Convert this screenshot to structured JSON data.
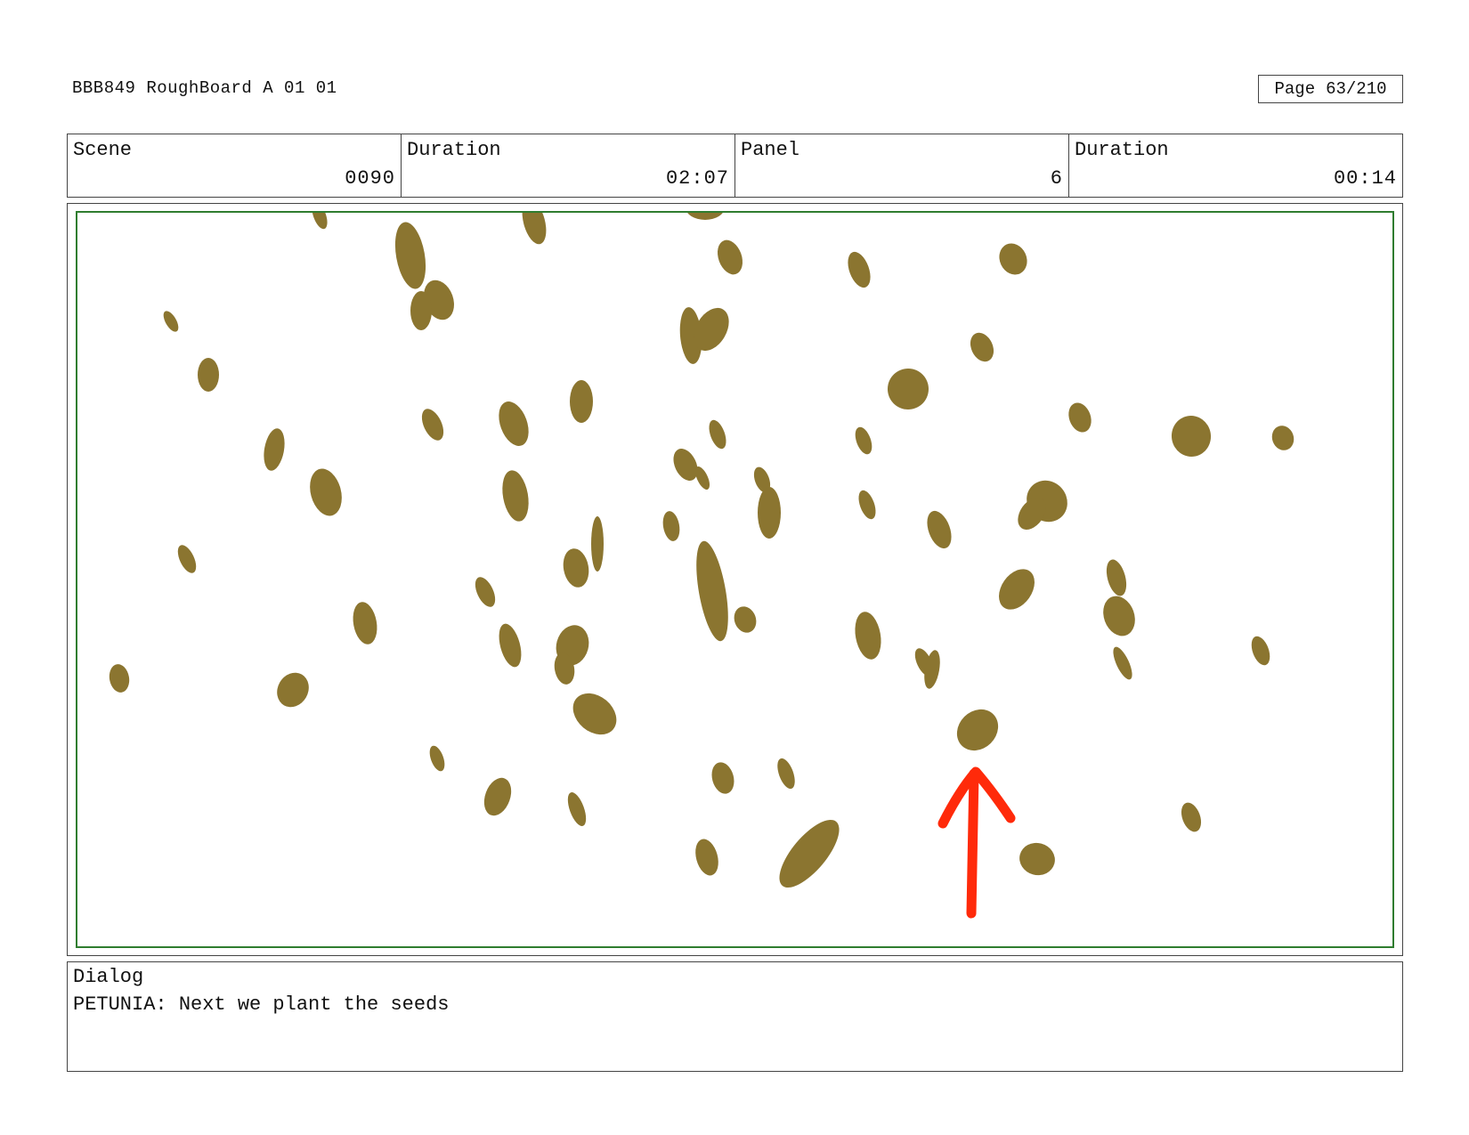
{
  "header": {
    "title": "BBB849 RoughBoard A 01 01",
    "page_label": "Page",
    "page_value": "63/210"
  },
  "info": {
    "scene_label": "Scene",
    "scene_value": "0090",
    "scene_duration_label": "Duration",
    "scene_duration_value": "02:07",
    "panel_label": "Panel",
    "panel_value": "6",
    "panel_duration_label": "Duration",
    "panel_duration_value": "00:14"
  },
  "drawing": {
    "seed_color": "#8b7530",
    "arrow_color": "#ff2a0a",
    "safe_frame_color": "#2f7d2f",
    "elements": [
      "seeds",
      "red-arrow-up"
    ]
  },
  "dialog": {
    "label": "Dialog",
    "text": "PETUNIA: Next we plant the seeds"
  }
}
